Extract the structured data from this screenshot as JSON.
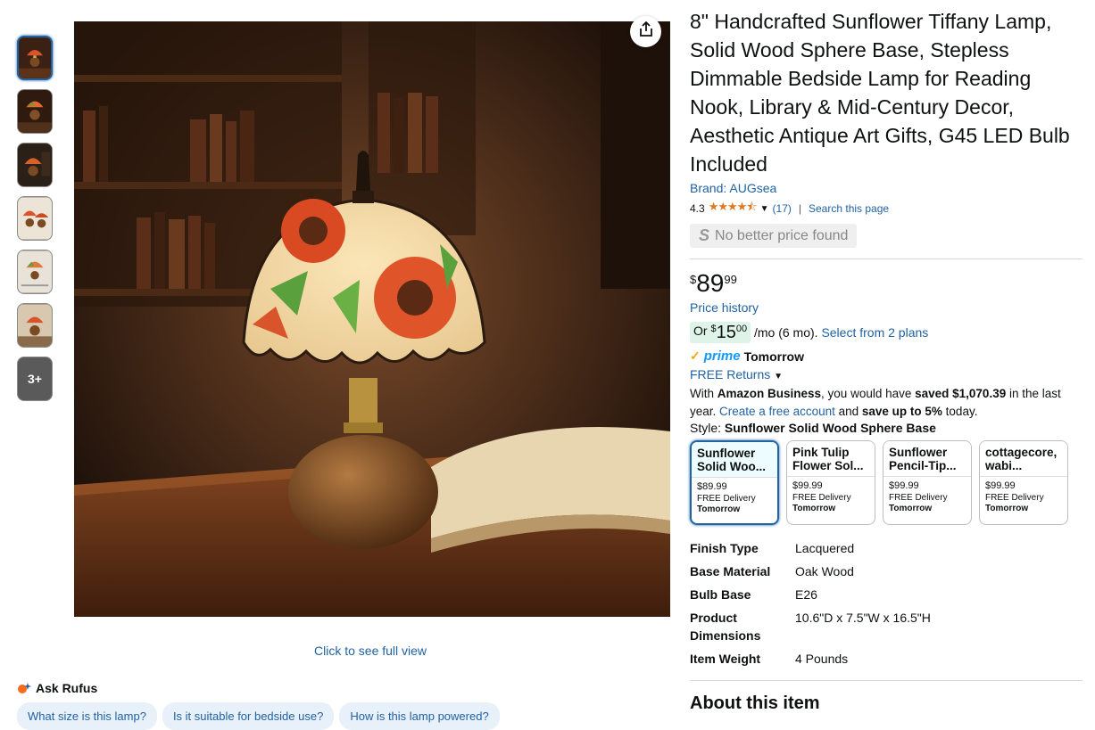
{
  "product": {
    "title": "8\" Handcrafted Sunflower Tiffany Lamp, Solid Wood Sphere Base, Stepless Dimmable Bedside Lamp for Reading Nook, Library & Mid-Century Decor, Aesthetic Antique Art Gifts, G45 LED Bulb Included",
    "brand_label": "Brand: AUGsea",
    "rating_value": "4.3",
    "rating_count": "(17)",
    "search_page": "Search this page",
    "no_better_price": "No better price found",
    "price_symbol": "$",
    "price_whole": "89",
    "price_fraction": "99",
    "price_history": "Price history",
    "monthly_prefix": "Or ",
    "monthly_symbol": "$",
    "monthly_whole": "15",
    "monthly_fraction": "00",
    "monthly_suffix": " /mo (6 mo). ",
    "monthly_plans": "Select from 2 plans",
    "prime_word": "prime",
    "prime_delivery": "Tomorrow",
    "returns": "FREE Returns",
    "business_1": "With ",
    "business_2": "Amazon Business",
    "business_3": ", you would have ",
    "business_4": "saved $1,070.39",
    "business_5": " in the last year. ",
    "business_6": "Create a free account",
    "business_7": " and ",
    "business_8": "save up to 5%",
    "business_9": " today.",
    "style_label": "Style: ",
    "style_value": "Sunflower Solid Wood Sphere Base"
  },
  "style_options": [
    {
      "title": "Sunflower Solid Woo...",
      "price": "$89.99",
      "delivery1": "FREE Delivery",
      "delivery2": "Tomorrow"
    },
    {
      "title": "Pink Tulip Flower Sol...",
      "price": "$99.99",
      "delivery1": "FREE Delivery",
      "delivery2": "Tomorrow"
    },
    {
      "title": "Sunflower Pencil-Tip...",
      "price": "$99.99",
      "delivery1": "FREE Delivery",
      "delivery2": "Tomorrow"
    },
    {
      "title": "cottagecore, wabi...",
      "price": "$99.99",
      "delivery1": "FREE Delivery",
      "delivery2": "Tomorrow"
    }
  ],
  "specs": [
    {
      "key": "Finish Type",
      "value": "Lacquered"
    },
    {
      "key": "Base Material",
      "value": "Oak Wood"
    },
    {
      "key": "Bulb Base",
      "value": "E26"
    },
    {
      "key": "Product Dimensions",
      "value": "10.6\"D x 7.5\"W x 16.5\"H"
    },
    {
      "key": "Item Weight",
      "value": "4 Pounds"
    }
  ],
  "about_heading": "About this item",
  "gallery": {
    "more_label": "3+",
    "full_view": "Click to see full view"
  },
  "rufus": {
    "label": "Ask Rufus",
    "chips": [
      "What size is this lamp?",
      "Is it suitable for bedside use?",
      "How is this lamp powered?"
    ]
  },
  "colors": {
    "link": "#2162A1",
    "star": "#DE7921",
    "prime": "#1399ff"
  }
}
